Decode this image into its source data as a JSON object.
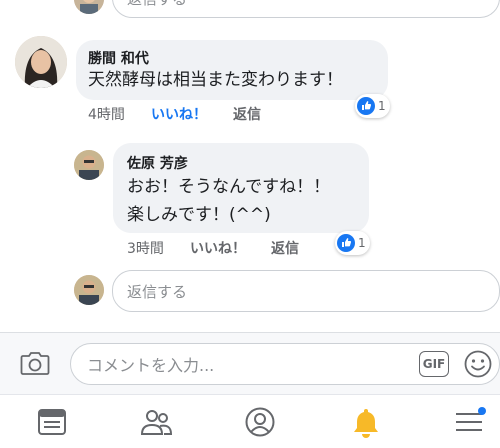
{
  "top_reply_placeholder": "返信する",
  "comments": [
    {
      "author": "勝間 和代",
      "text": "天然酵母は相当また変わります！",
      "time": "4時間",
      "like_label": "いいね！",
      "reply_label": "返信",
      "reaction_count": "1",
      "like_state": "liked"
    },
    {
      "author": "佐原 芳彦",
      "text_line1": "おお！そうなんですね！！",
      "text_line2": "楽しみです！(^^)",
      "time": "3時間",
      "like_label": "いいね！",
      "reply_label": "返信",
      "reaction_count": "1",
      "like_state": "not-liked"
    }
  ],
  "reply_box": {
    "placeholder": "返信する"
  },
  "composer": {
    "camera_icon": "camera-icon",
    "placeholder": "コメントを入力...",
    "gif_label": "GIF",
    "emoji_icon": "emoji-icon"
  },
  "tabs": [
    {
      "name": "news-feed-icon",
      "active": false
    },
    {
      "name": "friends-icon",
      "active": false
    },
    {
      "name": "profile-icon",
      "active": false
    },
    {
      "name": "notifications-bell-icon",
      "active": true
    },
    {
      "name": "menu-icon",
      "badge": true
    }
  ],
  "colors": {
    "accent": "#1877f2",
    "bell": "#f7b928",
    "bubble": "#f0f2f5",
    "meta_text": "#65676b"
  }
}
